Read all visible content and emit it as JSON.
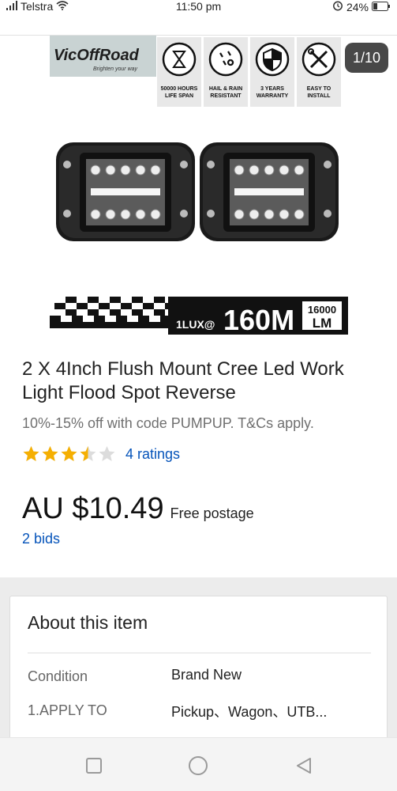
{
  "status_bar": {
    "carrier": "Telstra",
    "time": "11:50 pm",
    "battery": "24%"
  },
  "gallery": {
    "counter": "1/10",
    "brand_logo_text": "VicOffRoad",
    "brand_tagline": "Brighten your way",
    "features": [
      {
        "icon": "hourglass-icon",
        "label": "50000 HOURS LIFE SPAN"
      },
      {
        "icon": "rain-icon",
        "label": "HAIL & RAIN RESISTANT"
      },
      {
        "icon": "shield-icon",
        "label": "3 YEARS WARRANTY"
      },
      {
        "icon": "tools-icon",
        "label": "EASY TO INSTALL"
      }
    ],
    "banner_prefix": "1LUX@",
    "banner_main": "160M",
    "banner_lumens": "16000",
    "banner_lumens_unit": "LM"
  },
  "product": {
    "title": "2 X 4Inch Flush Mount Cree Led Work Light Flood Spot Reverse",
    "promo": "10%-15% off with code PUMPUP. T&Cs apply.",
    "rating_value": 3.5,
    "ratings_text": "4 ratings",
    "price": "AU $10.49",
    "shipping": "Free postage",
    "bids": "2 bids"
  },
  "about": {
    "title": "About this item",
    "specs": [
      {
        "label": "Condition",
        "value": "Brand New"
      },
      {
        "label": "1.APPLY TO",
        "value": "Pickup、Wagon、UTB..."
      }
    ]
  },
  "colors": {
    "link": "#0654ba",
    "star": "#f5af02",
    "star_empty": "#dcdcdc"
  },
  "nav": {
    "recent_icon": "square-icon",
    "home_icon": "circle-icon",
    "back_icon": "triangle-back-icon"
  }
}
